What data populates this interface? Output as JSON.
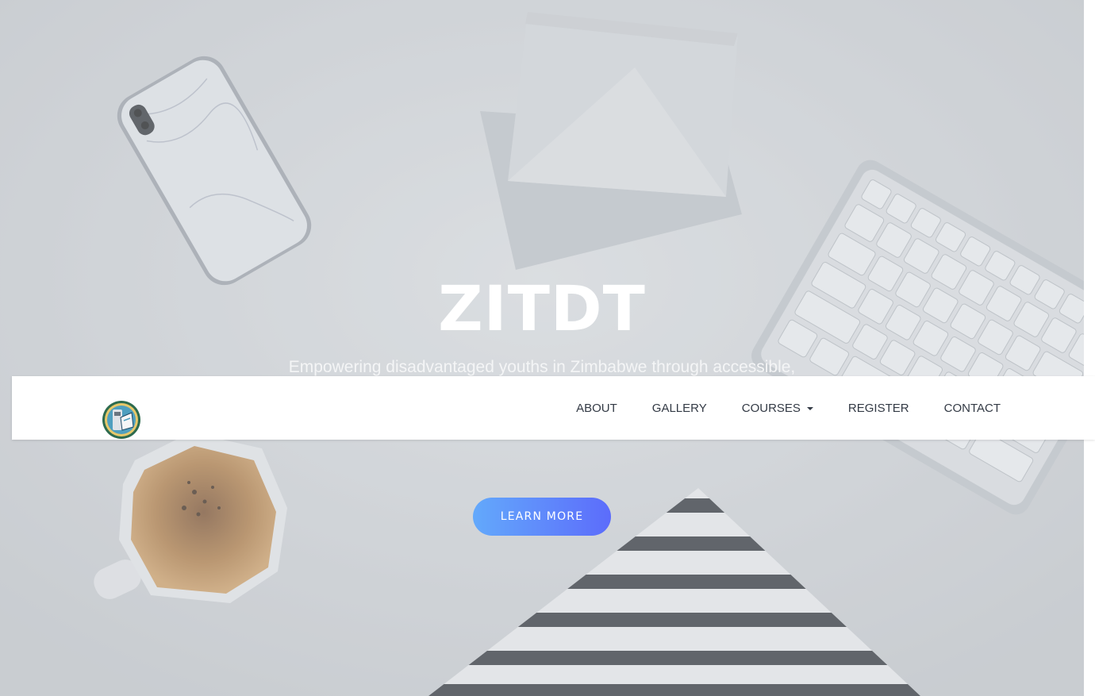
{
  "hero": {
    "title": "ZITDT",
    "subtitle": "Empowering disadvantaged youths in Zimbabwe through accessible, affordable and quality training for sustainable communities.",
    "cta_label": "LEARN MORE",
    "cta_gradient": [
      "#63a9fb",
      "#5c6cfb"
    ]
  },
  "nav": {
    "logo_icon": "organization-logo-icon",
    "items": [
      {
        "label": "ABOUT"
      },
      {
        "label": "GALLERY"
      },
      {
        "label": "COURSES",
        "has_dropdown": true
      },
      {
        "label": "REGISTER"
      },
      {
        "label": "CONTACT"
      }
    ]
  },
  "colors": {
    "nav_text": "#333a45",
    "nav_background": "#ffffff",
    "hero_text": "#ffffff"
  }
}
